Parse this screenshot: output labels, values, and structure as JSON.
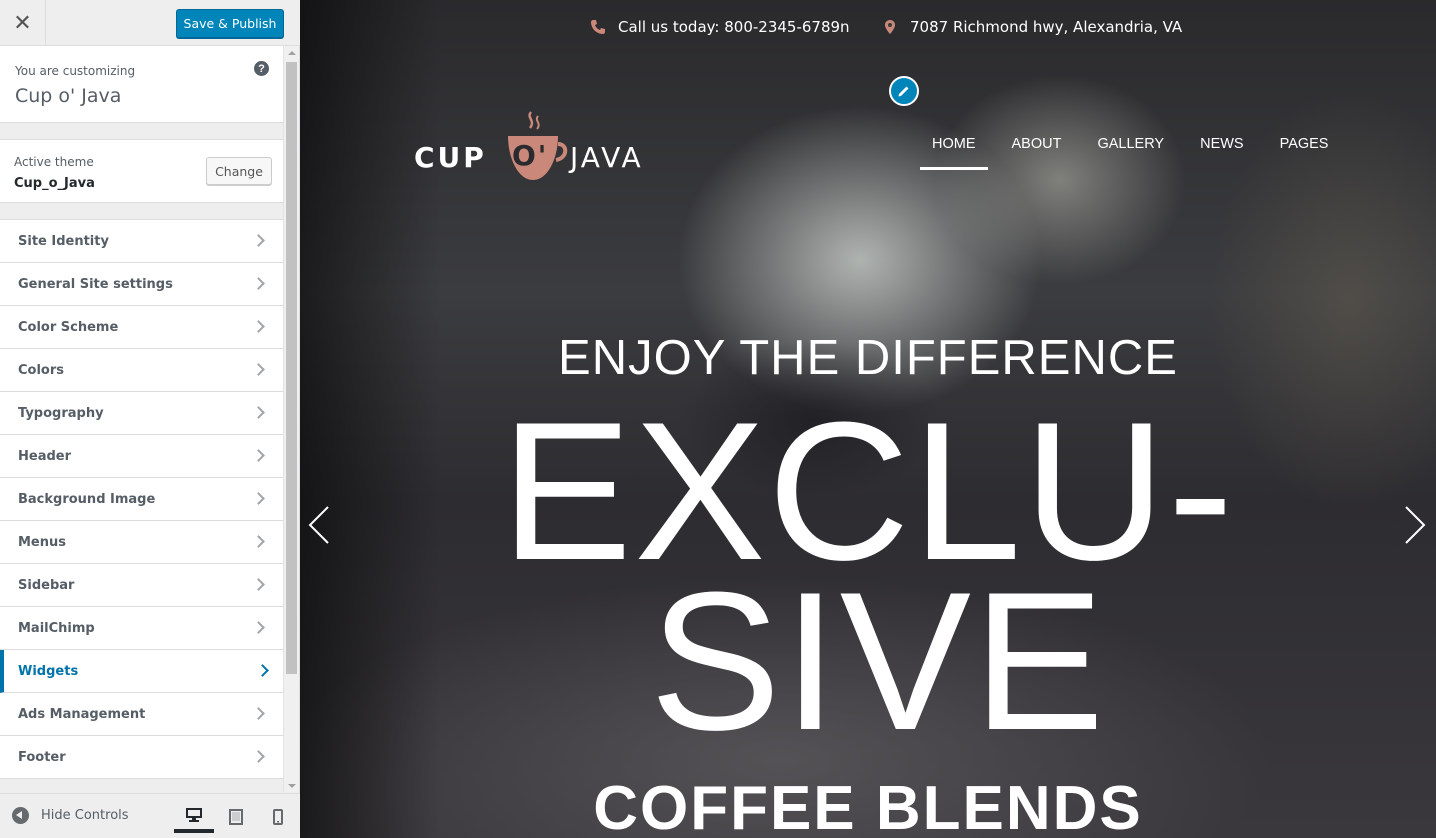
{
  "customizer": {
    "close_symbol": "✕",
    "save_publish": "Save & Publish",
    "customizing_label": "You are customizing",
    "site_name": "Cup o' Java",
    "help_symbol": "?",
    "active_theme_label": "Active theme",
    "active_theme_name": "Cup_o_Java",
    "change_label": "Change",
    "panels": [
      {
        "label": "Site Identity"
      },
      {
        "label": "General Site settings"
      },
      {
        "label": "Color Scheme"
      },
      {
        "label": "Colors"
      },
      {
        "label": "Typography"
      },
      {
        "label": "Header"
      },
      {
        "label": "Background Image"
      },
      {
        "label": "Menus"
      },
      {
        "label": "Sidebar"
      },
      {
        "label": "MailChimp"
      },
      {
        "label": "Widgets",
        "active": true
      },
      {
        "label": "Ads Management"
      },
      {
        "label": "Footer"
      }
    ],
    "hide_controls": "Hide Controls",
    "devices": [
      "desktop-icon",
      "tablet-icon",
      "mobile-icon"
    ],
    "accent_color": "#0085ba"
  },
  "site": {
    "phone": "Call us today: 800-2345-6789ո",
    "address": "7087 Richmond hwy, Alexandria, VA",
    "logo_text_left": "CUP",
    "logo_text_mid": "O'",
    "logo_text_right": "JAVA",
    "nav": [
      "HOME",
      "ABOUT",
      "GALLERY",
      "NEWS",
      "PAGES"
    ],
    "nav_active": "HOME",
    "hero": {
      "tagline": "ENJOY THE DIFFERENCE",
      "line1": "EXCLU-",
      "line2": "SIVE",
      "sub": "COFFEE BLENDS"
    },
    "icon_color": "#c9887a"
  }
}
